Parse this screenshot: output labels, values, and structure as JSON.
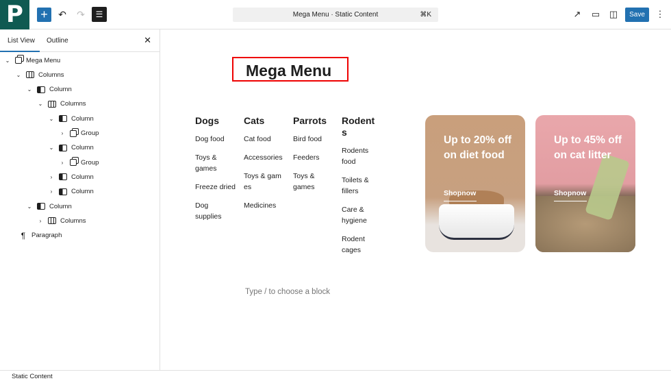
{
  "app": {
    "logo": "P"
  },
  "toolbar": {
    "command_title": "Mega Menu · Static Content",
    "shortcut": "⌘K",
    "save_label": "Save"
  },
  "sidebar": {
    "tabs": [
      "List View",
      "Outline"
    ],
    "tree": [
      {
        "label": "Mega Menu",
        "level": 0,
        "chevron": "down",
        "icon": "grp"
      },
      {
        "label": "Columns",
        "level": 1,
        "chevron": "down",
        "icon": "cols"
      },
      {
        "label": "Column",
        "level": 2,
        "chevron": "down",
        "icon": "col"
      },
      {
        "label": "Columns",
        "level": 3,
        "chevron": "down",
        "icon": "cols"
      },
      {
        "label": "Column",
        "level": 4,
        "chevron": "down",
        "icon": "col"
      },
      {
        "label": "Group",
        "level": 5,
        "chevron": "right",
        "icon": "grp"
      },
      {
        "label": "Column",
        "level": 4,
        "chevron": "down",
        "icon": "col"
      },
      {
        "label": "Group",
        "level": 5,
        "chevron": "right",
        "icon": "grp"
      },
      {
        "label": "Column",
        "level": 4,
        "chevron": "right",
        "icon": "col"
      },
      {
        "label": "Column",
        "level": 4,
        "chevron": "right",
        "icon": "col"
      },
      {
        "label": "Column",
        "level": 2,
        "chevron": "down",
        "icon": "col"
      },
      {
        "label": "Columns",
        "level": 3,
        "chevron": "right",
        "icon": "cols"
      },
      {
        "label": "Paragraph",
        "level": 0,
        "chevron": "none",
        "icon": "para"
      }
    ]
  },
  "canvas": {
    "title": "Mega Menu",
    "menus": [
      {
        "heading": "Dogs",
        "items": [
          "Dog food",
          "Toys & games",
          "Freeze dried",
          "Dog supplies"
        ]
      },
      {
        "heading": "Cats",
        "items": [
          "Cat food",
          "Accessories",
          "Toys & games",
          "Medicines"
        ]
      },
      {
        "heading": "Parrots",
        "items": [
          "Bird food",
          "Feeders",
          "Toys & games"
        ]
      },
      {
        "heading": "Rodents",
        "items": [
          "Rodents food",
          "Toilets & fillers",
          "Care & hygiene",
          "Rodent cages"
        ]
      }
    ],
    "cards": [
      {
        "text": "Up to 20% off on diet food",
        "link": "Shopnow"
      },
      {
        "text": "Up to 45% off on cat litter",
        "link": "Shopnow"
      }
    ],
    "placeholder": "Type / to choose a block"
  },
  "footer": {
    "breadcrumb": "Static Content"
  }
}
